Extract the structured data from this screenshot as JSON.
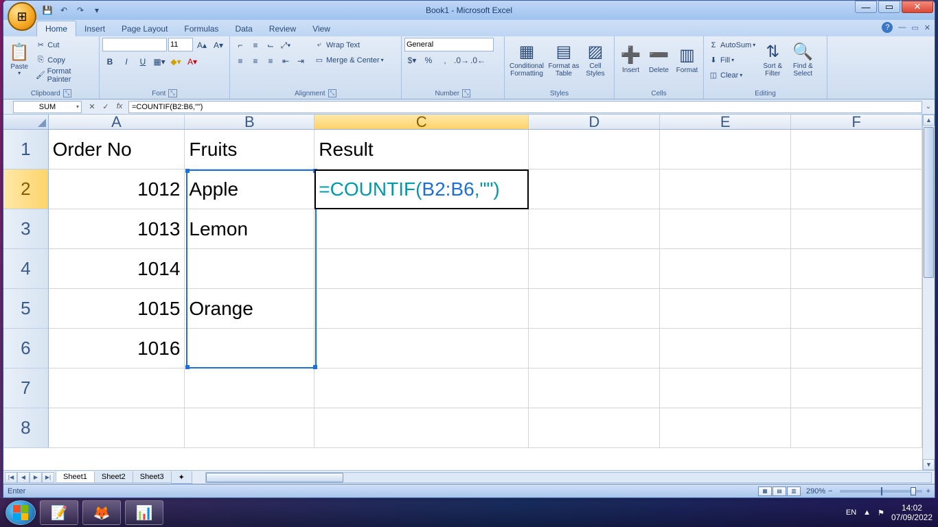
{
  "app": {
    "title": "Book1 - Microsoft Excel"
  },
  "qat": {
    "save": "💾",
    "undo": "↶",
    "redo": "↷"
  },
  "tabs": [
    "Home",
    "Insert",
    "Page Layout",
    "Formulas",
    "Data",
    "Review",
    "View"
  ],
  "ribbon": {
    "clipboard": {
      "paste": "Paste",
      "cut": "Cut",
      "copy": "Copy",
      "fp": "Format Painter",
      "label": "Clipboard"
    },
    "font": {
      "family": "",
      "size": "11",
      "label": "Font",
      "bold": "B",
      "italic": "I",
      "underline": "U"
    },
    "alignment": {
      "wrap": "Wrap Text",
      "merge": "Merge & Center",
      "label": "Alignment"
    },
    "number": {
      "format": "General",
      "label": "Number"
    },
    "styles": {
      "cf": "Conditional Formatting",
      "fat": "Format as Table",
      "cs": "Cell Styles",
      "label": "Styles"
    },
    "cells": {
      "insert": "Insert",
      "delete": "Delete",
      "format": "Format",
      "label": "Cells"
    },
    "editing": {
      "autosum": "AutoSum",
      "fill": "Fill",
      "clear": "Clear",
      "sort": "Sort & Filter",
      "find": "Find & Select",
      "label": "Editing"
    }
  },
  "formula_bar": {
    "namebox": "SUM",
    "formula_plain": "=COUNTIF(B2:B6,\"\")"
  },
  "columns": [
    "A",
    "B",
    "C",
    "D",
    "E",
    "F"
  ],
  "rows": [
    "1",
    "2",
    "3",
    "4",
    "5",
    "6",
    "7",
    "8"
  ],
  "cells": {
    "A1": "Order No",
    "B1": "Fruits",
    "C1": "Result",
    "A2": "1012",
    "B2": "Apple",
    "A3": "1013",
    "B3": "Lemon",
    "A4": "1014",
    "A5": "1015",
    "B5": "Orange",
    "A6": "1016"
  },
  "editing_cell": {
    "fn": "=COUNTIF(",
    "ref": "B2:B6",
    "rest": ",\"\")"
  },
  "sheets": [
    "Sheet1",
    "Sheet2",
    "Sheet3"
  ],
  "status": {
    "mode": "Enter",
    "zoom": "290%",
    "lang": "EN"
  },
  "clock": {
    "time": "14:02",
    "date": "07/09/2022"
  }
}
